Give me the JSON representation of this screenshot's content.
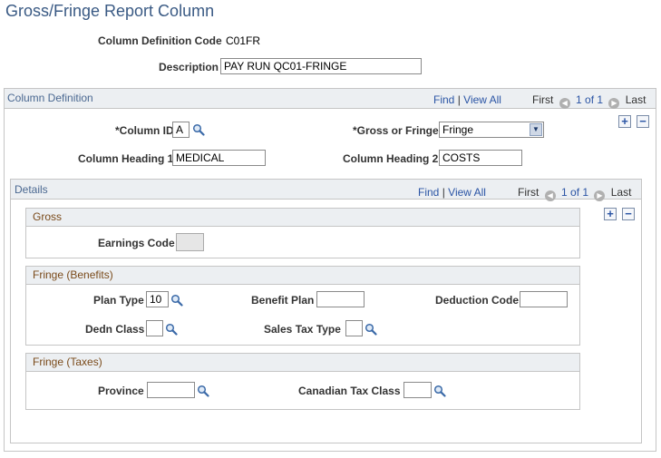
{
  "page": {
    "title": "Gross/Fringe Report Column",
    "column_definition_code_label": "Column Definition Code",
    "column_definition_code_value": "C01FR",
    "description_label": "Description",
    "description_value": "PAY RUN QC01-FRINGE"
  },
  "column_definition": {
    "section_title": "Column Definition",
    "nav": {
      "find": "Find",
      "separator": "|",
      "view_all": "View All",
      "first": "First",
      "counter": "1 of 1",
      "last": "Last"
    },
    "add_label": "+",
    "remove_label": "−",
    "column_id_label": "*Column ID",
    "column_id_value": "A",
    "gross_or_fringe_label": "*Gross or Fringe",
    "gross_or_fringe_value": "Fringe",
    "column_heading1_label": "Column Heading 1",
    "column_heading1_value": "MEDICAL",
    "column_heading2_label": "Column Heading 2",
    "column_heading2_value": "COSTS"
  },
  "details": {
    "section_title": "Details",
    "nav": {
      "find": "Find",
      "separator": "|",
      "view_all": "View All",
      "first": "First",
      "counter": "1 of 1",
      "last": "Last"
    },
    "add_label": "+",
    "remove_label": "−",
    "gross": {
      "title": "Gross",
      "earnings_code_label": "Earnings Code",
      "earnings_code_value": ""
    },
    "fringe_benefits": {
      "title": "Fringe (Benefits)",
      "plan_type_label": "Plan Type",
      "plan_type_value": "10",
      "benefit_plan_label": "Benefit Plan",
      "benefit_plan_value": "",
      "deduction_code_label": "Deduction Code",
      "deduction_code_value": "",
      "dedn_class_label": "Dedn Class",
      "dedn_class_value": "",
      "sales_tax_type_label": "Sales Tax Type",
      "sales_tax_type_value": ""
    },
    "fringe_taxes": {
      "title": "Fringe (Taxes)",
      "province_label": "Province",
      "province_value": "",
      "canadian_tax_class_label": "Canadian Tax Class",
      "canadian_tax_class_value": ""
    }
  },
  "icons": {
    "lookup": "magnifier-icon",
    "first": "arrow-left-icon",
    "last": "arrow-right-icon"
  },
  "colors": {
    "title": "#3a5a84",
    "link": "#2b55a5",
    "subsection_title": "#7a4a1a"
  }
}
